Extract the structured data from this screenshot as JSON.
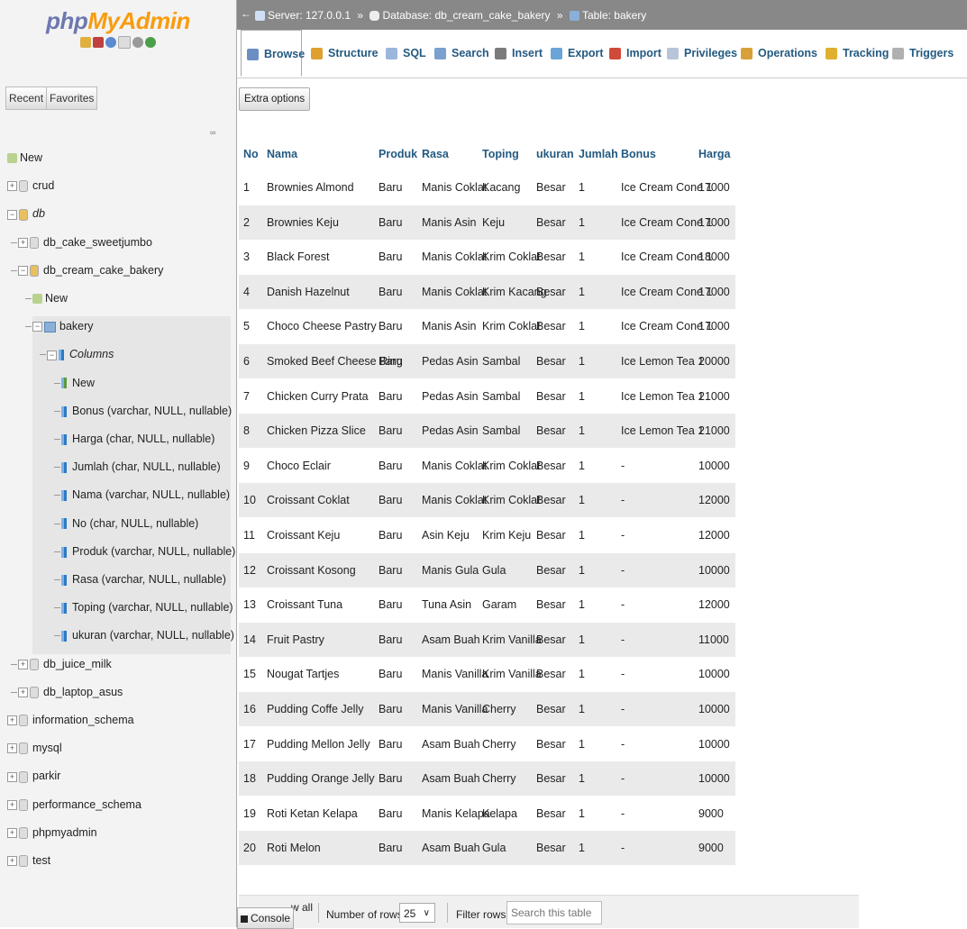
{
  "nav": {
    "logo_php": "php",
    "logo_my": "MyAdmin",
    "tabs": [
      "Recent",
      "Favorites"
    ],
    "collapse": "∞",
    "tree": [
      {
        "label": "New",
        "type": "new",
        "level": 0
      },
      {
        "label": "crud",
        "type": "db",
        "level": 0
      },
      {
        "label": "db",
        "type": "db-open",
        "level": 0
      },
      {
        "label": "db_cake_sweetjumbo",
        "type": "db",
        "level": 1
      },
      {
        "label": "db_cream_cake_bakery",
        "type": "db-open",
        "level": 1
      },
      {
        "label": "New",
        "type": "new",
        "level": 2
      },
      {
        "label": "bakery",
        "type": "table",
        "level": 2
      },
      {
        "label": "Columns",
        "type": "columns",
        "level": 3
      },
      {
        "label": "New",
        "type": "col-new",
        "level": 4
      },
      {
        "label": "Bonus (varchar, NULL, nullable)",
        "type": "col",
        "level": 4
      },
      {
        "label": "Harga (char, NULL, nullable)",
        "type": "col",
        "level": 4
      },
      {
        "label": "Jumlah (char, NULL, nullable)",
        "type": "col",
        "level": 4
      },
      {
        "label": "Nama (varchar, NULL, nullable)",
        "type": "col",
        "level": 4
      },
      {
        "label": "No (char, NULL, nullable)",
        "type": "col",
        "level": 4
      },
      {
        "label": "Produk (varchar, NULL, nullable)",
        "type": "col",
        "level": 4
      },
      {
        "label": "Rasa (varchar, NULL, nullable)",
        "type": "col",
        "level": 4
      },
      {
        "label": "Toping (varchar, NULL, nullable)",
        "type": "col",
        "level": 4
      },
      {
        "label": "ukuran (varchar, NULL, nullable)",
        "type": "col",
        "level": 4
      },
      {
        "label": "db_juice_milk",
        "type": "db",
        "level": 1
      },
      {
        "label": "db_laptop_asus",
        "type": "db",
        "level": 1
      },
      {
        "label": "information_schema",
        "type": "db",
        "level": 0
      },
      {
        "label": "mysql",
        "type": "db",
        "level": 0
      },
      {
        "label": "parkir",
        "type": "db",
        "level": 0
      },
      {
        "label": "performance_schema",
        "type": "db",
        "level": 0
      },
      {
        "label": "phpmyadmin",
        "type": "db",
        "level": 0
      },
      {
        "label": "test",
        "type": "db",
        "level": 0
      }
    ]
  },
  "breadcrumb": {
    "server": "Server: 127.0.0.1",
    "sep1": "»",
    "database": "Database: db_cream_cake_bakery",
    "sep2": "»",
    "table": "Table: bakery"
  },
  "tabs": [
    {
      "label": "Browse",
      "icon": "browse-icon",
      "color": "#6b8fc2"
    },
    {
      "label": "Structure",
      "icon": "structure-icon",
      "color": "#e0a030"
    },
    {
      "label": "SQL",
      "icon": "sql-icon",
      "color": "#9bb6dc"
    },
    {
      "label": "Search",
      "icon": "search-icon",
      "color": "#7aa0d0"
    },
    {
      "label": "Insert",
      "icon": "insert-icon",
      "color": "#7b7b7b"
    },
    {
      "label": "Export",
      "icon": "export-icon",
      "color": "#6aa5d8"
    },
    {
      "label": "Import",
      "icon": "import-icon",
      "color": "#d04a3a"
    },
    {
      "label": "Privileges",
      "icon": "privileges-icon",
      "color": "#b8c4d8"
    },
    {
      "label": "Operations",
      "icon": "operations-icon",
      "color": "#d8a038"
    },
    {
      "label": "Tracking",
      "icon": "tracking-icon",
      "color": "#e0b030"
    },
    {
      "label": "Triggers",
      "icon": "triggers-icon",
      "color": "#b0b0b0"
    }
  ],
  "extra_options": "Extra options",
  "table": {
    "headers": [
      "No",
      "Nama",
      "Produk",
      "Rasa",
      "Toping",
      "ukuran",
      "Jumlah",
      "Bonus",
      "Harga"
    ],
    "rows": [
      [
        "1",
        "Brownies Almond",
        "Baru",
        "Manis Coklat",
        "Kacang",
        "Besar",
        "1",
        "Ice Cream Cone 1",
        "17000"
      ],
      [
        "2",
        "Brownies Keju",
        "Baru",
        "Manis Asin",
        "Keju",
        "Besar",
        "1",
        "Ice Cream Cone 1",
        "17000"
      ],
      [
        "3",
        "Black Forest",
        "Baru",
        "Manis Coklat",
        "Krim Coklat",
        "Besar",
        "1",
        "Ice Cream Cone 1",
        "18000"
      ],
      [
        "4",
        "Danish Hazelnut",
        "Baru",
        "Manis Coklat",
        "Krim Kacang",
        "Besar",
        "1",
        "Ice Cream Cone 1",
        "17000"
      ],
      [
        "5",
        "Choco Cheese Pastry",
        "Baru",
        "Manis Asin",
        "Krim Coklat",
        "Besar",
        "1",
        "Ice Cream Cone 1",
        "17000"
      ],
      [
        "6",
        "Smoked Beef Cheese Ring",
        "Baru",
        "Pedas Asin",
        "Sambal",
        "Besar",
        "1",
        "Ice Lemon Tea 1",
        "20000"
      ],
      [
        "7",
        "Chicken Curry Prata",
        "Baru",
        "Pedas Asin",
        "Sambal",
        "Besar",
        "1",
        "Ice Lemon Tea 1",
        "21000"
      ],
      [
        "8",
        "Chicken Pizza Slice",
        "Baru",
        "Pedas Asin",
        "Sambal",
        "Besar",
        "1",
        "Ice Lemon Tea 1",
        "21000"
      ],
      [
        "9",
        "Choco Eclair",
        "Baru",
        "Manis Coklat",
        "Krim Coklat",
        "Besar",
        "1",
        "-",
        "10000"
      ],
      [
        "10",
        "Croissant Coklat",
        "Baru",
        "Manis Coklat",
        "Krim Coklat",
        "Besar",
        "1",
        "-",
        "12000"
      ],
      [
        "11",
        "Croissant Keju",
        "Baru",
        "Asin Keju",
        "Krim Keju",
        "Besar",
        "1",
        "-",
        "12000"
      ],
      [
        "12",
        "Croissant Kosong",
        "Baru",
        "Manis Gula",
        "Gula",
        "Besar",
        "1",
        "-",
        "10000"
      ],
      [
        "13",
        "Croissant Tuna",
        "Baru",
        "Tuna Asin",
        "Garam",
        "Besar",
        "1",
        "-",
        "12000"
      ],
      [
        "14",
        "Fruit Pastry",
        "Baru",
        "Asam Buah",
        "Krim Vanilla",
        "Besar",
        "1",
        "-",
        "11000"
      ],
      [
        "15",
        "Nougat Tartjes",
        "Baru",
        "Manis Vanilla",
        "Krim Vanilla",
        "Besar",
        "1",
        "-",
        "10000"
      ],
      [
        "16",
        "Pudding Coffe Jelly",
        "Baru",
        "Manis Vanilla",
        "Cherry",
        "Besar",
        "1",
        "-",
        "10000"
      ],
      [
        "17",
        "Pudding Mellon Jelly",
        "Baru",
        "Asam Buah",
        "Cherry",
        "Besar",
        "1",
        "-",
        "10000"
      ],
      [
        "18",
        "Pudding Orange Jelly",
        "Baru",
        "Asam Buah",
        "Cherry",
        "Besar",
        "1",
        "-",
        "10000"
      ],
      [
        "19",
        "Roti Ketan Kelapa",
        "Baru",
        "Manis Kelapa",
        "Kelapa",
        "Besar",
        "1",
        "-",
        "9000"
      ],
      [
        "20",
        "Roti Melon",
        "Baru",
        "Asam Buah",
        "Gula",
        "Besar",
        "1",
        "-",
        "9000"
      ]
    ]
  },
  "bottom": {
    "console": "Console",
    "show_all": "w all",
    "number_of_rows_label": "Number of rows:",
    "number_of_rows_value": "25",
    "filter_label": "Filter rows:",
    "filter_placeholder": "Search this table"
  }
}
